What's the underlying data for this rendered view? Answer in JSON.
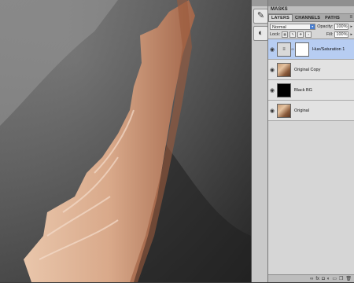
{
  "panel": {
    "masks_title": "MASKS",
    "tabs": [
      "LAYERS",
      "CHANNELS",
      "PATHS"
    ],
    "tab_menu": "≡",
    "blend_mode": "Normal",
    "opacity_label": "Opacity:",
    "opacity_value": "100%",
    "lock_label": "Lock:",
    "fill_label": "Fill:",
    "fill_value": "100%"
  },
  "layers": [
    {
      "name": "Hue/Saturation 1",
      "selected": true
    },
    {
      "name": "Original Copy",
      "selected": false
    },
    {
      "name": "Black BG",
      "selected": false
    },
    {
      "name": "Original",
      "selected": false
    }
  ],
  "tools": [
    "brush-tool-icon",
    "adjustment-tool-icon"
  ],
  "bottom_icons": [
    "link-icon",
    "fx-icon",
    "mask-icon",
    "adjustment-icon",
    "group-icon",
    "new-layer-icon",
    "trash-icon"
  ],
  "colors": {
    "canvas_gray": "#5c5c5c",
    "fabric_skin": "#d9a98a",
    "selection_blue": "#b7cdf2"
  }
}
